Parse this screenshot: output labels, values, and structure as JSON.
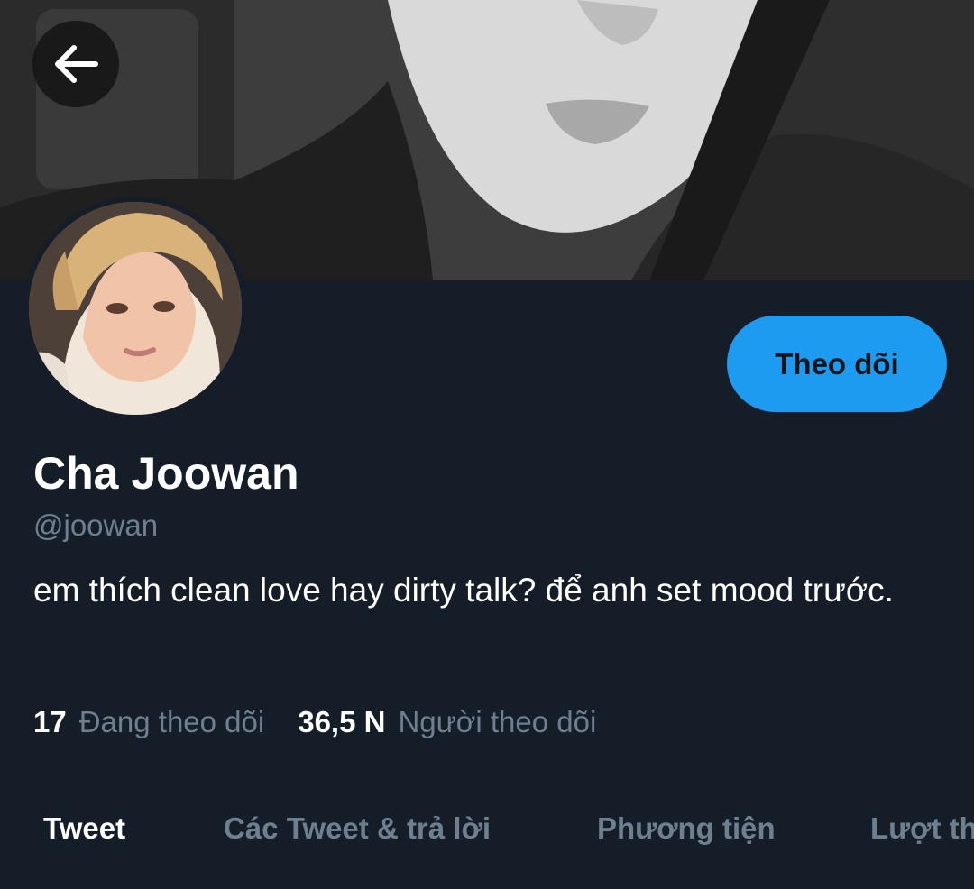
{
  "profile": {
    "display_name": "Cha Joowan",
    "handle": "@joowan",
    "bio": "em thích clean love hay dirty talk? để anh set mood trước.",
    "follow_label": "Theo dõi"
  },
  "stats": {
    "following_count": "17",
    "following_label": "Đang theo dõi",
    "followers_count": "36,5 N",
    "followers_label": "Người theo dõi"
  },
  "tabs": [
    {
      "label": "Tweet",
      "active": true
    },
    {
      "label": "Các Tweet & trả lời",
      "active": false
    },
    {
      "label": "Phương tiện",
      "active": false
    },
    {
      "label": "Lượt thích",
      "active": false
    }
  ],
  "icons": {
    "back": "arrow-left-icon"
  },
  "colors": {
    "background": "#151d29",
    "accent": "#1d9bf0",
    "secondary_text": "#6e7f8f"
  }
}
